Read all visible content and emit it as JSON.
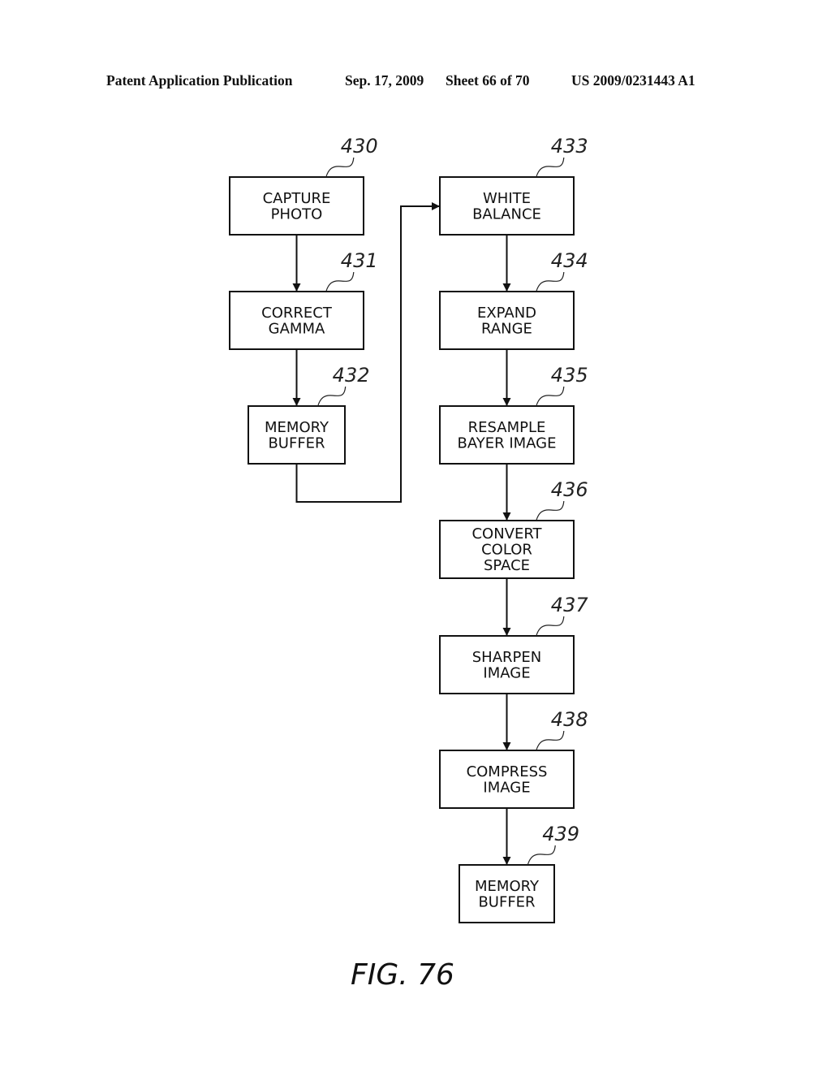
{
  "header": {
    "publication": "Patent Application Publication",
    "date": "Sep. 17, 2009",
    "sheet": "Sheet 66 of 70",
    "number": "US 2009/0231443 A1"
  },
  "figure": {
    "label": "FIG. 76"
  },
  "steps": [
    {
      "id": "430",
      "lines": [
        "CAPTURE",
        "PHOTO"
      ]
    },
    {
      "id": "431",
      "lines": [
        "CORRECT",
        "GAMMA"
      ]
    },
    {
      "id": "432",
      "lines": [
        "MEMORY",
        "BUFFER"
      ]
    },
    {
      "id": "433",
      "lines": [
        "WHITE",
        "BALANCE"
      ]
    },
    {
      "id": "434",
      "lines": [
        "EXPAND",
        "RANGE"
      ]
    },
    {
      "id": "435",
      "lines": [
        "RESAMPLE",
        "BAYER IMAGE"
      ]
    },
    {
      "id": "436",
      "lines": [
        "CONVERT",
        "COLOR",
        "SPACE"
      ]
    },
    {
      "id": "437",
      "lines": [
        "SHARPEN",
        "IMAGE"
      ]
    },
    {
      "id": "438",
      "lines": [
        "COMPRESS",
        "IMAGE"
      ]
    },
    {
      "id": "439",
      "lines": [
        "MEMORY",
        "BUFFER"
      ]
    }
  ],
  "connections": [
    [
      "430",
      "431"
    ],
    [
      "431",
      "432"
    ],
    [
      "432",
      "433"
    ],
    [
      "433",
      "434"
    ],
    [
      "434",
      "435"
    ],
    [
      "435",
      "436"
    ],
    [
      "436",
      "437"
    ],
    [
      "437",
      "438"
    ],
    [
      "438",
      "439"
    ]
  ]
}
